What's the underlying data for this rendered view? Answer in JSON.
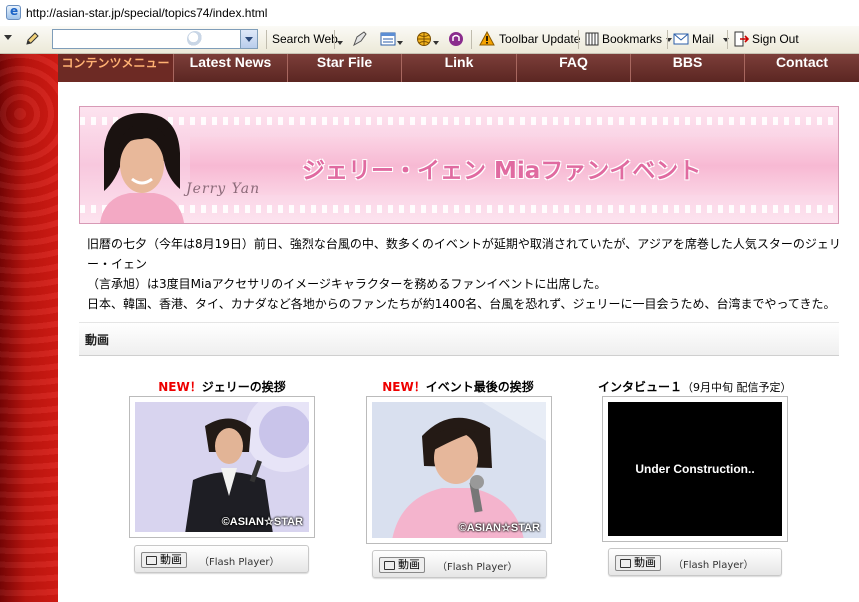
{
  "browser": {
    "url": "http://asian-star.jp/special/topics74/index.html",
    "toolbar": {
      "search_web": "Search Web",
      "toolbar_update": "Toolbar Update",
      "bookmarks": "Bookmarks",
      "mail": "Mail",
      "sign_out": "Sign Out"
    }
  },
  "nav": {
    "items": [
      {
        "label": "コンテンツメニュー"
      },
      {
        "label": "Latest News"
      },
      {
        "label": "Star File"
      },
      {
        "label": "Link"
      },
      {
        "label": "FAQ"
      },
      {
        "label": "BBS"
      },
      {
        "label": "Contact"
      }
    ]
  },
  "banner": {
    "title": "ジェリー・イェン Miaファンイベント",
    "signature": "Jerry Yan"
  },
  "intro": {
    "line1": "旧暦の七夕（今年は8月19日）前日、強烈な台風の中、数多くのイベントが延期や取消されていたが、アジアを席巻した人気スターのジェリー・イェン",
    "line2": "（言承旭）は3度目Miaアクセサリのイメージキャラクターを務めるファンイベントに出席した。",
    "line3": "日本、韓国、香港、タイ、カナダなど各地からのファンたちが約1400名、台風を恐れず、ジェリーに一目会うため、台湾までやってきた。"
  },
  "section": {
    "title": "動画"
  },
  "videos": [
    {
      "new_label": "NEW！",
      "title": "ジェリーの挨拶",
      "note": "",
      "copyright": "©ASIAN☆STAR",
      "button_label": "動画",
      "player": "（Flash Player）"
    },
    {
      "new_label": "NEW！",
      "title": "イベント最後の挨拶",
      "note": "",
      "copyright": "©ASIAN☆STAR",
      "button_label": "動画",
      "player": "（Flash Player）"
    },
    {
      "new_label": "",
      "title": "インタビュー１",
      "note": "（9月中旬 配信予定）",
      "screen_text": "Under Construction..",
      "button_label": "動画",
      "player": "（Flash Player）"
    }
  ],
  "colors": {
    "nav_bg": "#6a2e29",
    "nav_active_text": "#ffb173",
    "accent_red": "#d81b14",
    "new_red": "#ee0000",
    "banner_pink": "#f8c8de",
    "banner_title": "#e06aa0"
  }
}
